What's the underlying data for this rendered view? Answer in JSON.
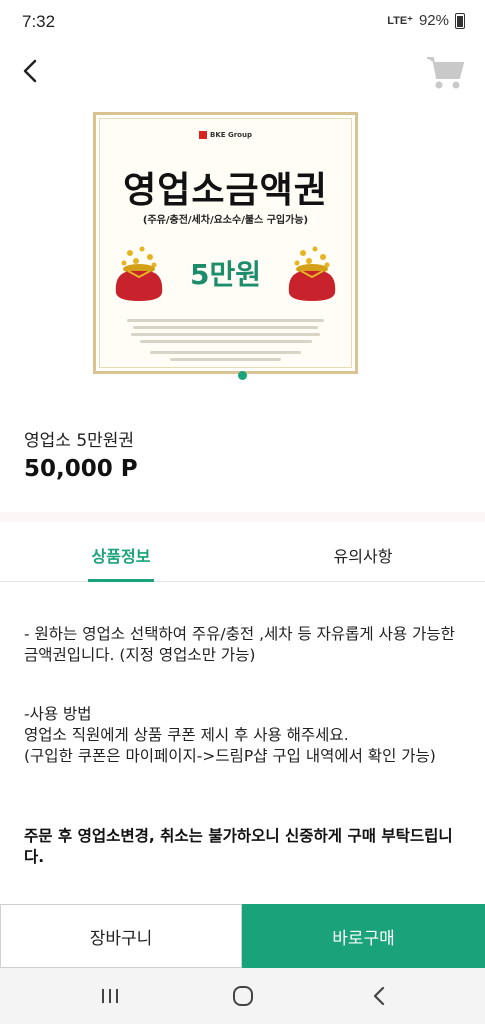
{
  "status": {
    "time": "7:32",
    "network": "LTE⁺",
    "battery": "92%"
  },
  "header": {
    "back_icon": "chevron-left-icon",
    "cart_icon": "cart-icon"
  },
  "voucher": {
    "brand": "BKE Group",
    "title": "영업소금액권",
    "subtitle": "(주유/충전/세차/요소수/불스 구입가능)",
    "amount": "5만원"
  },
  "product": {
    "name": "영업소 5만원권",
    "price": "50,000 P"
  },
  "tabs": [
    {
      "label": "상품정보",
      "active": true
    },
    {
      "label": "유의사항",
      "active": false
    }
  ],
  "content": {
    "para1": "- 원하는 영업소 선택하여 주유/충전 ,세차 등 자유롭게 사용 가능한 금액권입니다. (지정 영업소만 가능)",
    "para2_line1": "-사용 방법",
    "para2_line2": "영업소 직원에게 상품 쿠폰 제시 후 사용 해주세요.",
    "para2_line3": "(구입한 쿠폰은 마이페이지->드림P샵 구입 내역에서 확인 가능)",
    "para3": "주문 후 영업소변경, 취소는 불가하오니 신중하게 구매 부탁드립니다."
  },
  "actions": {
    "cart_label": "장바구니",
    "buy_label": "바로구매"
  },
  "colors": {
    "accent": "#1aa37a"
  }
}
